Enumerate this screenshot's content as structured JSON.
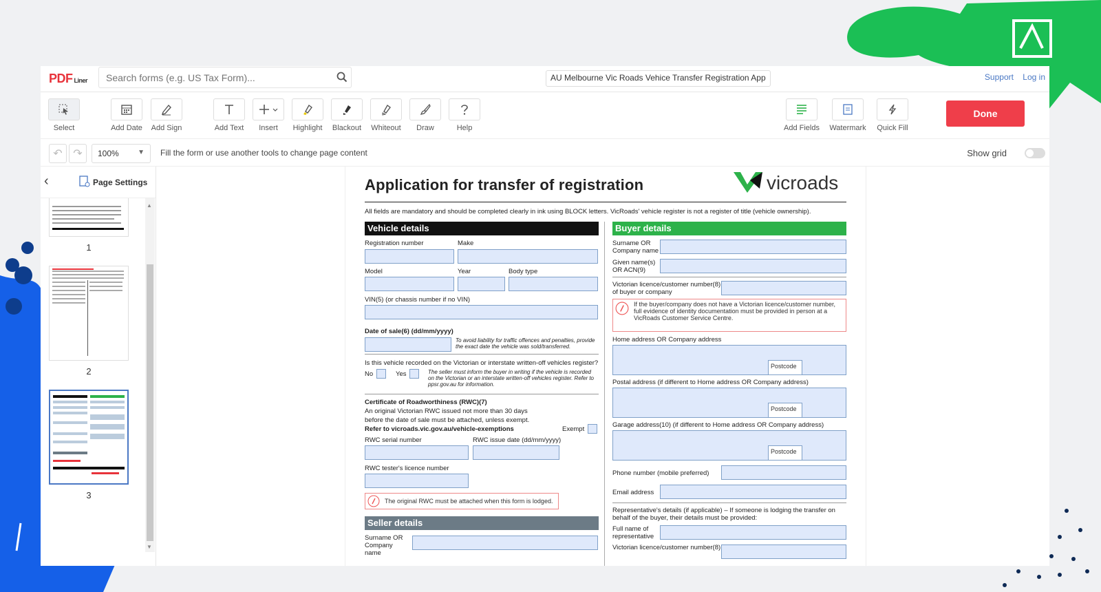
{
  "colors": {
    "brand_red": "#e8333b",
    "done_red": "#ef3e4a",
    "link_blue": "#4a78c4",
    "green": "#1bbf55",
    "deco_blue": "#1560e8",
    "vic_green": "#2db24a",
    "field_fill": "#dfe9fb",
    "seller_gray": "#6c7b86"
  },
  "header": {
    "logo": "PDF",
    "logo_suffix": "Liner",
    "search_placeholder": "Search forms (e.g. US Tax Form)...",
    "doc_title": "AU Melbourne Vic Roads Vehice Transfer Registration App",
    "support": "Support",
    "login": "Log in"
  },
  "toolbar": {
    "tools": [
      {
        "label": "Select",
        "icon": "select-icon"
      },
      {
        "label": "Add Date",
        "icon": "calendar-icon"
      },
      {
        "label": "Add Sign",
        "icon": "pen-icon"
      },
      {
        "label": "Add Text",
        "icon": "text-icon"
      },
      {
        "label": "Insert",
        "icon": "plus-icon"
      },
      {
        "label": "Highlight",
        "icon": "highlighter-icon"
      },
      {
        "label": "Blackout",
        "icon": "blackout-icon"
      },
      {
        "label": "Whiteout",
        "icon": "eraser-icon"
      },
      {
        "label": "Draw",
        "icon": "brush-icon"
      },
      {
        "label": "Help",
        "icon": "help-icon"
      },
      {
        "label": "Add Fields",
        "icon": "fields-icon"
      },
      {
        "label": "Watermark",
        "icon": "watermark-icon"
      },
      {
        "label": "Quick Fill",
        "icon": "lightning-icon"
      }
    ],
    "done": "Done"
  },
  "history": {
    "zoom": "100%",
    "hint": "Fill the form or use another tools to change page content",
    "show_grid": "Show grid"
  },
  "sidebar": {
    "page_settings": "Page Settings",
    "pages": [
      "1",
      "2",
      "3"
    ]
  },
  "form": {
    "title": "Application for transfer of registration",
    "brand": "vicroads",
    "intro": "All fields are mandatory and should be completed clearly in ink using BLOCK letters. VicRoads' vehicle register is not a register of title (vehicle ownership).",
    "vehicle": {
      "heading": "Vehicle details",
      "reg": "Registration number",
      "make": "Make",
      "model": "Model",
      "year": "Year",
      "body": "Body type",
      "vin": "VIN(5) (or chassis number if no VIN)",
      "date_of_sale": "Date of sale(6) (dd/mm/yyyy)",
      "dos_note": "To avoid liability for traffic offences and penalties, provide the exact date the vehicle was sold/transferred.",
      "written_off": "Is this vehicle recorded on the Victorian or interstate written-off vehicles register?",
      "no": "No",
      "yes": "Yes",
      "wo_note": "The seller must inform the buyer in writing if the vehicle is recorded on the Victorian or an interstate written-off vehicles register. Refer to ppsr.gov.au for information.",
      "rwc_title": "Certificate of Roadworthiness (RWC)(7)",
      "rwc_text1": "An original Victorian RWC issued not more than 30 days",
      "rwc_text2": "before the date of sale must be attached, unless exempt.",
      "rwc_text3": "Refer to vicroads.vic.gov.au/vehicle-exemptions",
      "exempt": "Exempt",
      "rwc_serial": "RWC serial number",
      "rwc_date": "RWC issue date (dd/mm/yyyy)",
      "rwc_tester": "RWC tester's licence number",
      "rwc_note": "The original RWC must be attached when this form is lodged."
    },
    "seller": {
      "heading": "Seller details",
      "surname": "Surname OR Company name"
    },
    "buyer": {
      "heading": "Buyer details",
      "surname": "Surname OR Company name",
      "given": "Given name(s) OR ACN(9)",
      "licence": "Victorian licence/customer number(8) of buyer or company",
      "note": "If the buyer/company does not have a Victorian licence/customer number, full evidence of identity documentation must be provided in person at a VicRoads Customer Service Centre.",
      "home": "Home address OR Company address",
      "postcode": "Postcode",
      "postal": "Postal address (if different to Home address OR Company address)",
      "garage": "Garage address(10) (if different to Home address OR Company address)",
      "phone": "Phone number (mobile preferred)",
      "email": "Email address",
      "rep": "Representative's details (if applicable) – If someone is lodging the transfer on behalf of the buyer, their details must be provided:",
      "rep_name": "Full name of representative",
      "rep_lic": "Victorian licence/customer number(8)"
    }
  }
}
